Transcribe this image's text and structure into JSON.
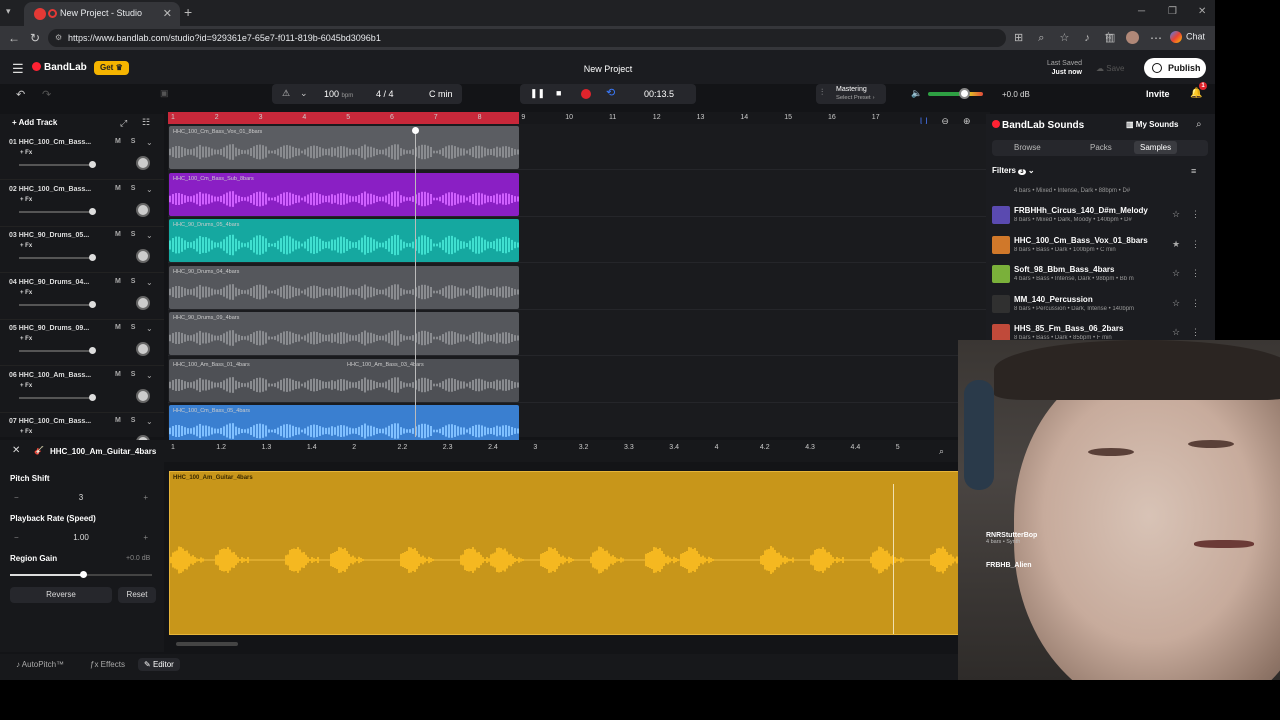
{
  "browser": {
    "tab_title": "New Project - Studio",
    "url": "https://www.bandlab.com/studio?id=929361e7-65e7-f011-819b-6045bd3096b1",
    "chat_label": "Chat"
  },
  "app": {
    "logo": "BandLab",
    "get_label": "Get",
    "project_title": "New Project",
    "last_saved_label": "Last Saved",
    "last_saved_value": "Just now",
    "save_label": "Save",
    "publish_label": "Publish",
    "invite_label": "Invite",
    "notification_count": "1"
  },
  "transport": {
    "bpm": "100",
    "bpm_unit": "bpm",
    "time_sig": "4 / 4",
    "key": "C min",
    "time": "00:13.5",
    "mastering_title": "Mastering",
    "mastering_preset": "Select Preset",
    "output_db": "+0.0 dB"
  },
  "tracks_panel": {
    "add_track": "Add Track",
    "tracks": [
      {
        "name": "01  HHC_100_Cm_Bass...",
        "fx": "+ Fx"
      },
      {
        "name": "02  HHC_100_Cm_Bass...",
        "fx": "+ Fx"
      },
      {
        "name": "03  HHC_90_Drums_05...",
        "fx": "+ Fx"
      },
      {
        "name": "04  HHC_90_Drums_04...",
        "fx": "+ Fx"
      },
      {
        "name": "05  HHC_90_Drums_09...",
        "fx": "+ Fx"
      },
      {
        "name": "06  HHC_100_Am_Bass...",
        "fx": "+ Fx"
      },
      {
        "name": "07  HHC_100_Cm_Bass...",
        "fx": "+ Fx"
      }
    ],
    "ms_label": "M S"
  },
  "ruler": [
    "1",
    "2",
    "3",
    "4",
    "5",
    "6",
    "7",
    "8",
    "9",
    "10",
    "11",
    "12",
    "13",
    "14",
    "15",
    "16",
    "17"
  ],
  "clips": [
    {
      "label": "HHC_100_Cm_Bass_Vox_01_8bars",
      "color": "#5b5d62"
    },
    {
      "label": "HHC_100_Cm_Bass_Sub_8bars",
      "color": "#8a1fc4"
    },
    {
      "label": "HHC_90_Drums_05_4bars",
      "color": "#15a8a0"
    },
    {
      "label": "HHC_90_Drums_04_4bars",
      "color": "#55575c"
    },
    {
      "label": "HHC_90_Drums_09_4bars",
      "color": "#55575c"
    },
    {
      "label": "HHC_100_Am_Bass_01_4bars",
      "label2": "HHC_100_Am_Bass_03_4bars",
      "color": "#4e5055"
    },
    {
      "label": "HHC_100_Cm_Bass_05_4bars",
      "color": "#3a7fd0"
    }
  ],
  "sounds": {
    "title": "BandLab Sounds",
    "my_sounds": "My Sounds",
    "tabs": [
      "Browse",
      "Packs",
      "Samples"
    ],
    "filters_label": "Filters",
    "filters_count": "3",
    "partial_meta": "4 bars • Mixed • Intense, Dark • 88bpm • D#",
    "items": [
      {
        "title": "FRBHHh_Circus_140_D#m_Melody",
        "meta": "8 bars • Mixed • Dark, Moody • 140bpm • D#",
        "color": "#5a4ab0"
      },
      {
        "title": "HHC_100_Cm_Bass_Vox_01_8bars",
        "meta": "8 bars • Bass • Dark • 100bpm • C min",
        "color": "#d0782a"
      },
      {
        "title": "Soft_98_Bbm_Bass_4bars",
        "meta": "4 bars • Bass • Intense, Dark • 98bpm • Bb m",
        "color": "#7ab03a"
      },
      {
        "title": "MM_140_Percussion",
        "meta": "8 bars • Percussion • Dark, Intense • 140bpm",
        "color": "#303030"
      },
      {
        "title": "HHS_85_Fm_Bass_06_2bars",
        "meta": "8 bars • Bass • Dark • 85bpm • F min",
        "color": "#c04a3a"
      }
    ],
    "cam_items": [
      {
        "title": "RNRStutterBop",
        "meta": "4 bars • Synth"
      },
      {
        "title": "FRBHB_Alien",
        "meta": ""
      }
    ]
  },
  "editor": {
    "clip_name": "HHC_100_Am_Guitar_4bars",
    "ruler": [
      "1",
      "1.2",
      "1.3",
      "1.4",
      "2",
      "2.2",
      "2.3",
      "2.4",
      "3",
      "3.2",
      "3.3",
      "3.4",
      "4",
      "4.2",
      "4.3",
      "4.4",
      "5"
    ],
    "pitch_label": "Pitch Shift",
    "pitch_value": "3",
    "rate_label": "Playback Rate (Speed)",
    "rate_value": "1.00",
    "gain_label": "Region Gain",
    "gain_value": "+0.0 dB",
    "gain_level": 0.5,
    "reverse_label": "Reverse",
    "reset_label": "Reset"
  },
  "bottom": {
    "autopitch": "AutoPitch™",
    "effects": "Effects",
    "editor": "Editor"
  }
}
